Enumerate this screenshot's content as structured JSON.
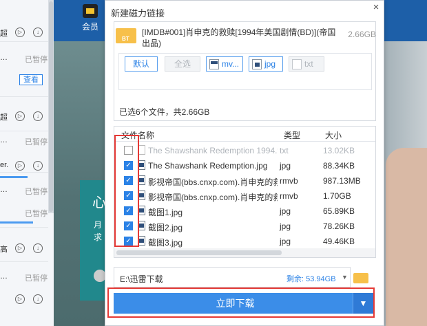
{
  "background": {
    "vip_label": "会员",
    "card_title": "心",
    "card_text": "月\n求",
    "left_rows": [
      {
        "text": "超",
        "status": ""
      },
      {
        "text": "…",
        "status": "已暂停",
        "view": "查看"
      },
      {
        "text": "超",
        "status": ""
      },
      {
        "text": "…",
        "status": "已暂停"
      },
      {
        "text": "er.",
        "status": ""
      },
      {
        "text": "…",
        "status": "已暂停"
      },
      {
        "text": "",
        "status": "已暂停"
      },
      {
        "text": "高",
        "status": ""
      },
      {
        "text": "…",
        "status": "已暂停"
      },
      {
        "text": "",
        "status": ""
      }
    ],
    "view_label": "查看"
  },
  "dialog": {
    "title": "新建磁力链接",
    "close": "×",
    "torrent": {
      "icon_label": "BT",
      "name": "[IMDB#001]肖申克的救赎[1994年美国剧情(BD)](帝国出品)",
      "size": "2.66GB"
    },
    "filters": [
      {
        "label": "默认",
        "state": "on",
        "icon": ""
      },
      {
        "label": "全选",
        "state": "off",
        "icon": ""
      },
      {
        "label": "mv...",
        "state": "on",
        "icon": "vid"
      },
      {
        "label": "jpg",
        "state": "on",
        "icon": "img"
      },
      {
        "label": "txt",
        "state": "off",
        "icon": "doc"
      }
    ],
    "selection_info": "已选6个文件，共2.66GB",
    "table": {
      "headers": {
        "name": "文件名称",
        "type": "类型",
        "size": "大小"
      },
      "rows": [
        {
          "checked": false,
          "name": "The Shawshank Redemption 1994.txt",
          "type": "txt",
          "size": "13.02KB",
          "dim": true
        },
        {
          "checked": true,
          "name": "The Shawshank Redemption.jpg",
          "type": "jpg",
          "size": "88.34KB",
          "dim": false
        },
        {
          "checked": true,
          "name": "影视帝国(bbs.cnxp.com).肖申克的救赎....",
          "type": "rmvb",
          "size": "987.13MB",
          "dim": false
        },
        {
          "checked": true,
          "name": "影视帝国(bbs.cnxp.com).肖申克的救赎....",
          "type": "rmvb",
          "size": "1.70GB",
          "dim": false
        },
        {
          "checked": true,
          "name": "截图1.jpg",
          "type": "jpg",
          "size": "65.89KB",
          "dim": false
        },
        {
          "checked": true,
          "name": "截图2.jpg",
          "type": "jpg",
          "size": "78.26KB",
          "dim": false
        },
        {
          "checked": true,
          "name": "截图3.jpg",
          "type": "jpg",
          "size": "49.46KB",
          "dim": false
        }
      ]
    },
    "path": "E:\\迅雷下载",
    "free_space": "剩余: 53.94GB",
    "download_label": "立即下载",
    "colors": {
      "accent": "#3b8de8",
      "highlight": "#e53935",
      "folder": "#f7c04a"
    }
  }
}
